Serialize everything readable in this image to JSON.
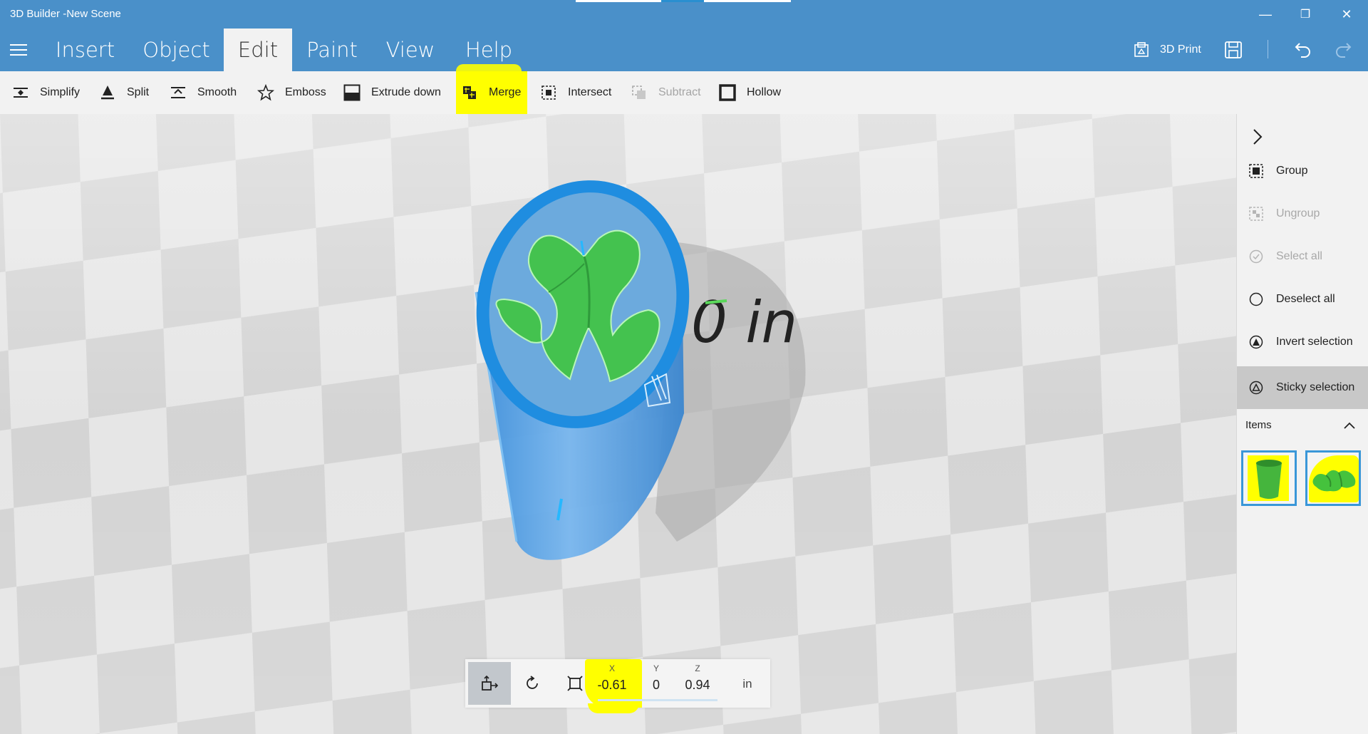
{
  "window": {
    "title": "3D Builder -New Scene",
    "controls": {
      "minimize": "—",
      "maximize": "❐",
      "close": "✕"
    }
  },
  "menu": {
    "tabs": [
      {
        "label": "Insert"
      },
      {
        "label": "Object"
      },
      {
        "label": "Edit",
        "active": true
      },
      {
        "label": "Paint"
      },
      {
        "label": "View"
      },
      {
        "label": "Help"
      }
    ],
    "print_label": "3D Print"
  },
  "toolbar": {
    "items": [
      {
        "label": "Simplify",
        "icon": "simplify-icon"
      },
      {
        "label": "Split",
        "icon": "split-icon"
      },
      {
        "label": "Smooth",
        "icon": "smooth-icon"
      },
      {
        "label": "Emboss",
        "icon": "star-icon"
      },
      {
        "label": "Extrude down",
        "icon": "extrude-down-icon"
      },
      {
        "label": "Merge",
        "icon": "merge-icon",
        "highlighted": true
      },
      {
        "label": "Intersect",
        "icon": "intersect-icon"
      },
      {
        "label": "Subtract",
        "icon": "subtract-icon",
        "disabled": true
      },
      {
        "label": "Hollow",
        "icon": "hollow-icon"
      }
    ]
  },
  "viewport": {
    "measure_label": "0 in"
  },
  "panel": {
    "items": [
      {
        "label": "Group"
      },
      {
        "label": "Ungroup",
        "disabled": true
      },
      {
        "label": "Select all",
        "disabled": true
      },
      {
        "label": "Deselect all"
      },
      {
        "label": "Invert selection"
      },
      {
        "label": "Sticky selection",
        "active": true
      }
    ],
    "items_header": "Items"
  },
  "position": {
    "x_label": "X",
    "x_value": "-0.61",
    "y_label": "Y",
    "y_value": "0",
    "z_label": "Z",
    "z_value": "0.94",
    "unit": "in"
  },
  "colors": {
    "accent": "#4a90c9",
    "highlight": "#ffff00",
    "object_blue": "#4f9be0",
    "object_green": "#3fbf4a"
  }
}
